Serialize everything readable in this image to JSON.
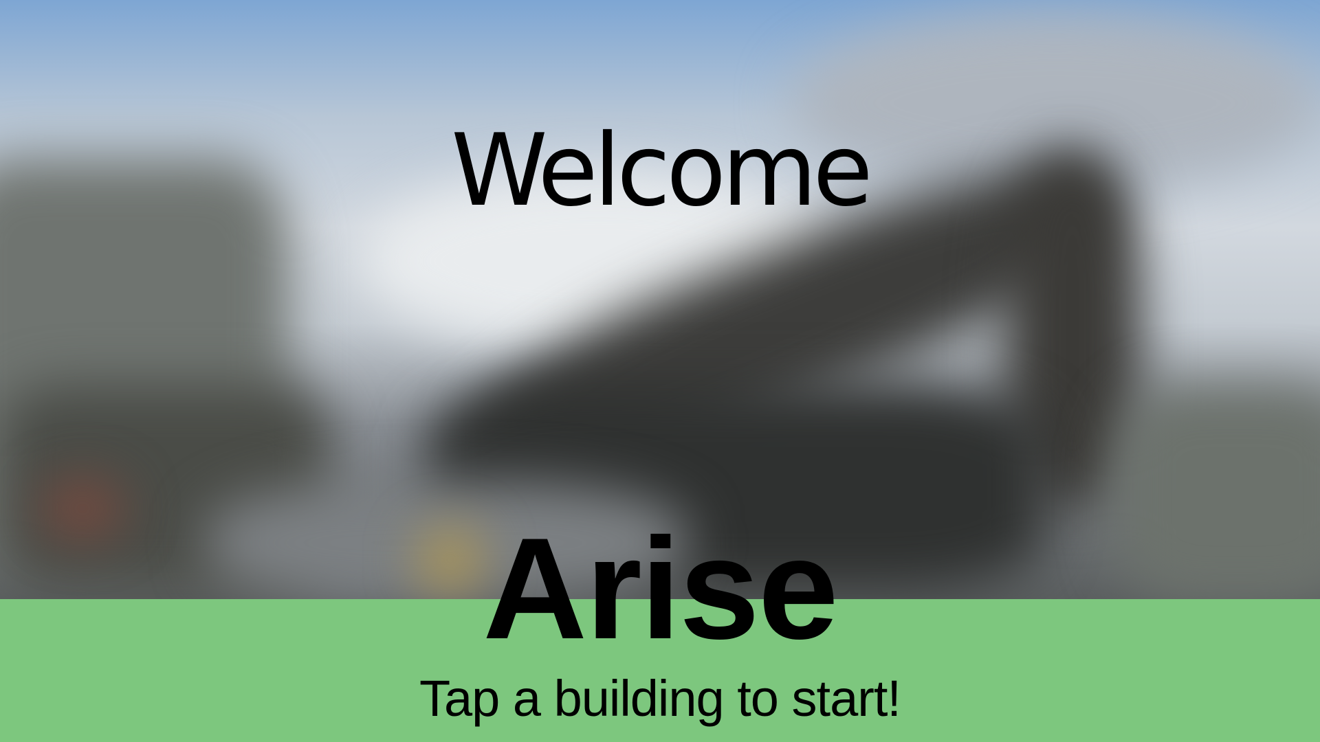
{
  "screen": {
    "welcome_title": "Welcome",
    "app_name": "Arise",
    "prompt": "Tap a building to start!"
  },
  "colors": {
    "bottom_band": "#7dc77e",
    "text": "#000000"
  }
}
